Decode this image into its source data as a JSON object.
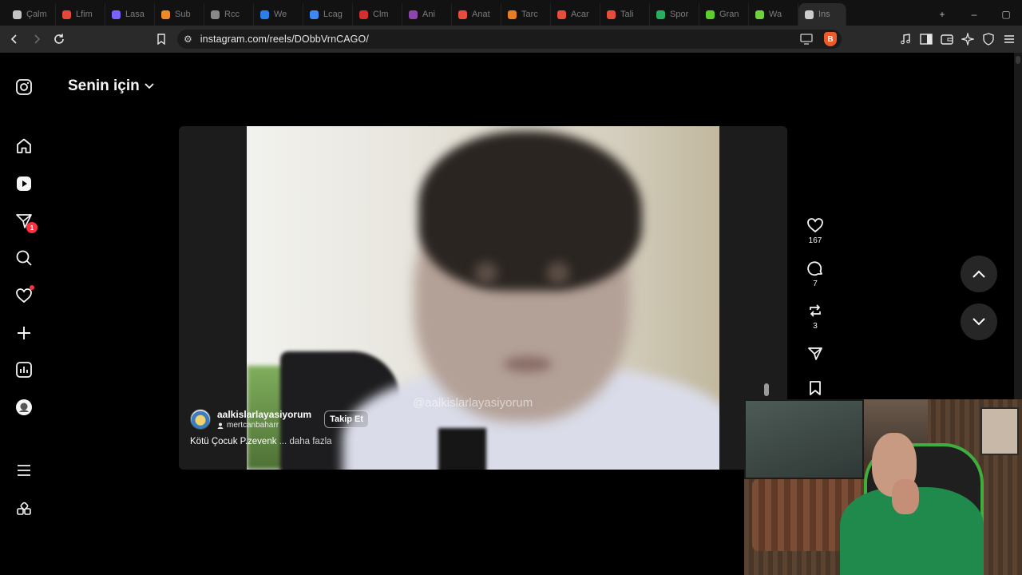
{
  "browser": {
    "tabs": [
      {
        "label": "Çalm",
        "color": "#c4c4c4"
      },
      {
        "label": "Lfim",
        "color": "#e2483b"
      },
      {
        "label": "Lasa",
        "color": "#7b61ff"
      },
      {
        "label": "Sub",
        "color": "#f08a24"
      },
      {
        "label": "Rcc",
        "color": "#888888"
      },
      {
        "label": "We",
        "color": "#2b7de9"
      },
      {
        "label": "Lcag",
        "color": "#3e88f5"
      },
      {
        "label": "Clm",
        "color": "#d32f2f"
      },
      {
        "label": "Ani",
        "color": "#8e44ad"
      },
      {
        "label": "Anat",
        "color": "#e74c3c"
      },
      {
        "label": "Tarc",
        "color": "#e67e22"
      },
      {
        "label": "Acar",
        "color": "#e74c3c"
      },
      {
        "label": "Tali",
        "color": "#e74c3c"
      },
      {
        "label": "Spor",
        "color": "#27ae60"
      },
      {
        "label": "Gran",
        "color": "#5ccf2b"
      },
      {
        "label": "Wa",
        "color": "#6fd13b"
      },
      {
        "label": "Ins",
        "color": "#cccccc",
        "active": true
      }
    ],
    "url": "instagram.com/reels/DObbVrnCAGO/",
    "brave_accent": "#f05a28"
  },
  "sidebar": {
    "items": [
      {
        "name": "instagram-logo-icon"
      },
      {
        "name": "home-icon"
      },
      {
        "name": "reels-icon"
      },
      {
        "name": "messages-icon",
        "badge": "1"
      },
      {
        "name": "search-icon"
      },
      {
        "name": "notifications-icon"
      },
      {
        "name": "create-icon"
      },
      {
        "name": "dashboard-icon"
      },
      {
        "name": "profile-avatar-icon"
      },
      {
        "name": "more-menu-icon"
      },
      {
        "name": "also-from-meta-icon"
      }
    ]
  },
  "feed": {
    "title": "Senin için"
  },
  "reel": {
    "watermark": "@aalkislarlayasiyorum",
    "username": "aalkislarlayasiyorum",
    "audio": "mertcanbaharr",
    "follow_label": "Takip Et",
    "caption": "Kötü Çocuk P.zevenk",
    "caption_more": "... daha fazla",
    "likes": "167",
    "comments": "7",
    "reposts": "3"
  },
  "colors": {
    "notification_red": "#ff3040"
  }
}
